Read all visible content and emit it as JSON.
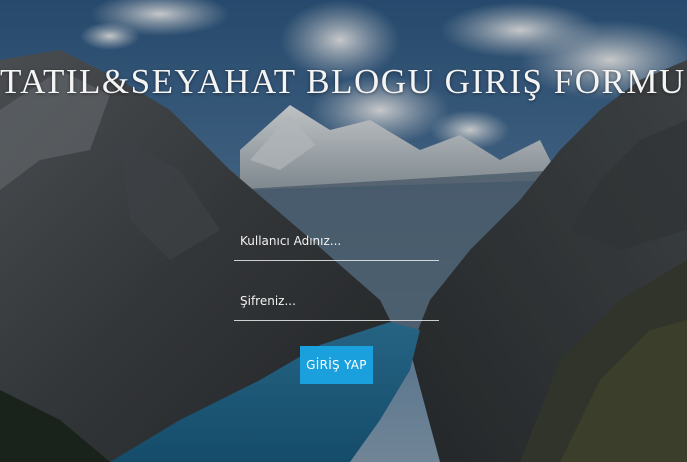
{
  "header": {
    "title": "TATIL&SEYAHAT BLOGU GIRIŞ FORMU"
  },
  "form": {
    "username_placeholder": "Kullanıcı Adınız...",
    "username_value": "",
    "password_placeholder": "Şifreniz...",
    "password_value": "",
    "submit_label": "GİRİŞ YAP"
  },
  "colors": {
    "button": "#1aa0dc",
    "text": "#ffffff"
  }
}
